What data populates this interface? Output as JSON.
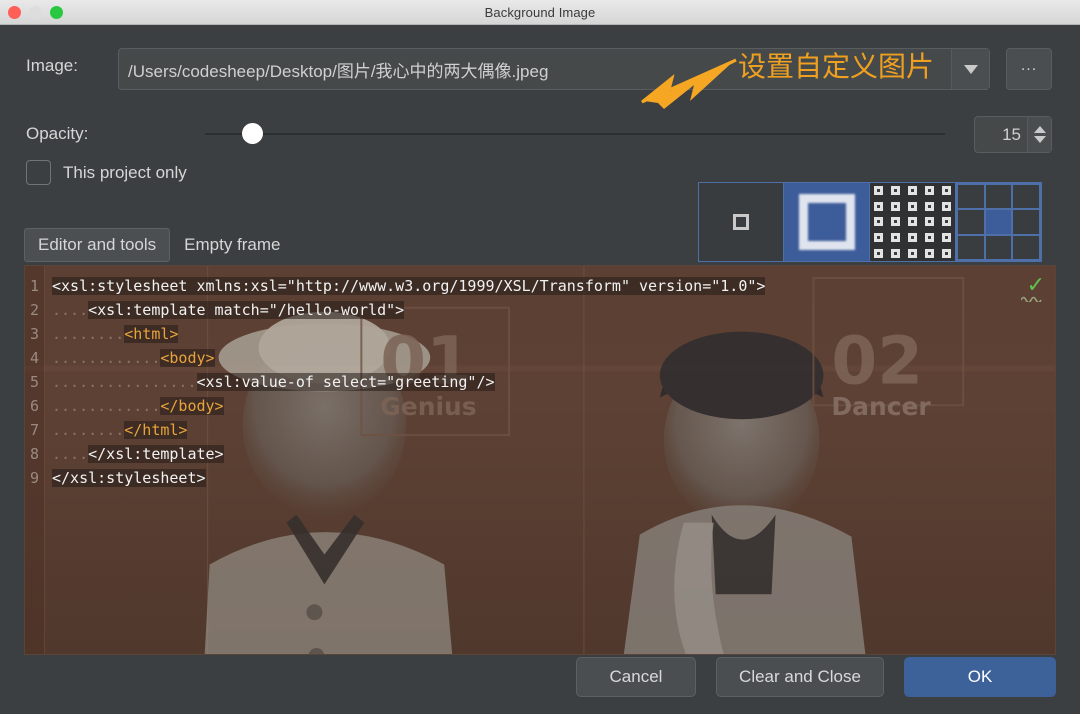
{
  "window": {
    "title": "Background Image",
    "traffic_lights": [
      "close-red",
      "minimize-yellow",
      "maximize-green"
    ]
  },
  "form": {
    "image_label": "Image:",
    "image_path": "/Users/codesheep/Desktop/图片/我心中的两大偶像.jpeg",
    "image_path_placeholder": "",
    "dropdown_icon": "chevron-down-icon",
    "browse_label": "...",
    "opacity_label": "Opacity:",
    "opacity_value": "15",
    "opacity_min": "0",
    "opacity_max": "100",
    "project_only_label": "This project only",
    "project_only_checked": "false"
  },
  "annotation": {
    "text": "设置自定义图片",
    "color": "#f0a020",
    "arrow": "arrow-pointing-left-down"
  },
  "fill_modes": [
    {
      "name": "center",
      "selected": "false"
    },
    {
      "name": "scaled",
      "selected": "true"
    },
    {
      "name": "tiled",
      "selected": "false"
    },
    {
      "name": "anchor-grid",
      "selected": "false"
    }
  ],
  "anchor_cells": [
    "off",
    "off",
    "off",
    "off",
    "on",
    "off",
    "off",
    "off",
    "off"
  ],
  "tabs": [
    {
      "label": "Editor and tools",
      "active": "true"
    },
    {
      "label": "Empty frame",
      "active": "false"
    }
  ],
  "preview": {
    "accent_bg": "#553a2e",
    "inspection_icon": "green-checkmark-icon",
    "photo_captions": [
      {
        "number": "01",
        "role": "Genius"
      },
      {
        "number": "02",
        "role": "Dancer"
      }
    ],
    "code_lines": [
      {
        "n": "1",
        "indent": "",
        "text": "<xsl:stylesheet xmlns:xsl=\"http://www.w3.org/1999/XSL/Transform\" version=\"1.0\">",
        "style": "tag"
      },
      {
        "n": "2",
        "indent": "....",
        "text": "<xsl:template match=\"/hello-world\">",
        "style": "tag"
      },
      {
        "n": "3",
        "indent": "........",
        "text": "<html>",
        "style": "html"
      },
      {
        "n": "4",
        "indent": "............",
        "text": "<body>",
        "style": "html"
      },
      {
        "n": "5",
        "indent": "................",
        "text": "<xsl:value-of select=\"greeting\"/>",
        "style": "tag"
      },
      {
        "n": "6",
        "indent": "............",
        "text": "</body>",
        "style": "html"
      },
      {
        "n": "7",
        "indent": "........",
        "text": "</html>",
        "style": "html"
      },
      {
        "n": "8",
        "indent": "....",
        "text": "</xsl:template>",
        "style": "tag"
      },
      {
        "n": "9",
        "indent": "",
        "text": "</xsl:stylesheet>",
        "style": "tag"
      }
    ]
  },
  "buttons": {
    "cancel": "Cancel",
    "clear_and_close": "Clear and Close",
    "ok": "OK",
    "ok_color": "#3d6199"
  }
}
